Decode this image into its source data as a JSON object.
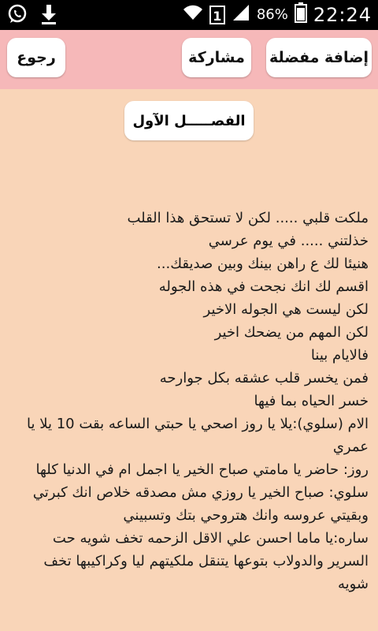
{
  "status": {
    "battery_pct": "86%",
    "time": "22:24",
    "sim": "1"
  },
  "toolbar": {
    "back_label": "رجوع",
    "share_label": "مشاركة",
    "favorite_label": "إضافة مفضلة"
  },
  "chapter_title": "الفصـــــل الآول",
  "lines": [
    "ملكت قلبي ..... لكن لا تستحق هذا القلب",
    "خذلتني ..... في يوم عرسي",
    "هنيئا لك ع راهن بينك وبين صديقك...",
    "اقسم لك انك نجحت في هذه الجوله",
    "لكن ليست هي الجوله الاخير",
    "لكن المهم من يضحك اخير",
    "فالايام بينا",
    "فمن يخسر قلب عشقه بكل جوارحه",
    "خسر الحياه بما فيها",
    "الام (سلوي):يلا يا روز اصحي يا حبتي الساعه بقت 10 يلا يا عمري",
    "روز: حاضر يا مامتي صباح الخير يا اجمل ام في الدنيا كلها",
    "سلوي: صباح الخير يا روزي مش مصدقه خلاص انك كبرتي وبقيتي عروسه وانك هتروحي بتك وتسبيني",
    "ساره:يا ماما احسن علي الاقل الزحمه تخف شويه حت السرير والدولاب بتوعها يتنقل ملكيتهم ليا وكراكيبها تخف شويه"
  ]
}
